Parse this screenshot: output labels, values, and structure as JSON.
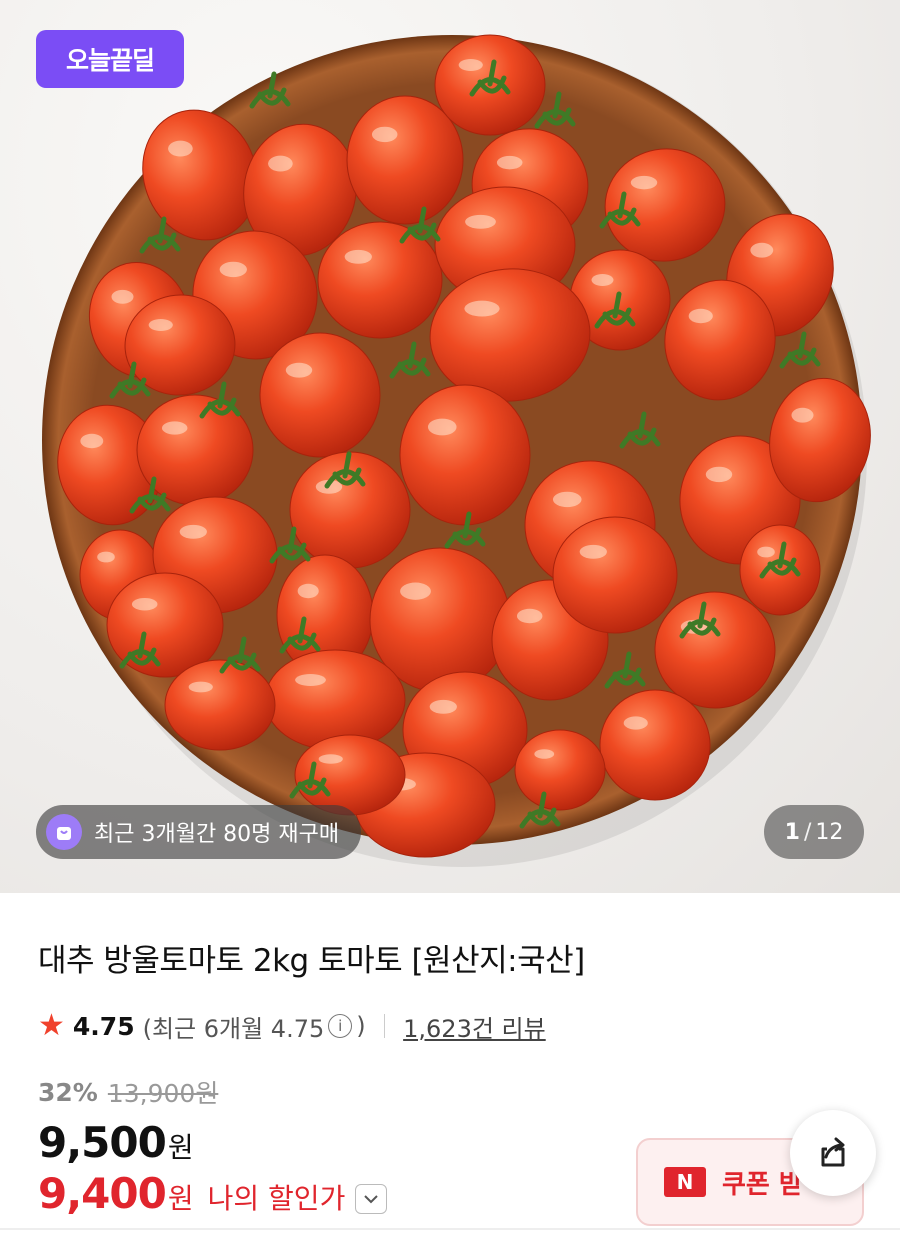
{
  "hero": {
    "deal_badge": "오늘끝딜",
    "repurchase_text": "최근 3개월간 80명 재구매",
    "image_counter": {
      "current": "1",
      "separator": "/",
      "total": "12"
    }
  },
  "product": {
    "title": "대추 방울토마토 2kg 토마토 [원산지:국산]"
  },
  "rating": {
    "score": "4.75",
    "recent_prefix": "(최근 6개월 4.75",
    "info_glyph": "i",
    "recent_suffix": ")",
    "review_count": "1,623건 리뷰"
  },
  "price": {
    "discount_rate": "32%",
    "original_price": "13,900원",
    "sale_price": "9,500",
    "sale_unit": "원",
    "my_price": "9,400",
    "my_unit": "원",
    "my_label": "나의 할인가"
  },
  "actions": {
    "coupon_logo": "N",
    "coupon_label": "쿠폰 받"
  },
  "colors": {
    "deal_purple": "#7b4df5",
    "sale_red": "#e0252d",
    "star_red": "#f0412c"
  },
  "icons": [
    "shopping-bag-icon",
    "star-icon",
    "info-icon",
    "chevron-down-icon",
    "share-icon",
    "naver-n-icon"
  ]
}
